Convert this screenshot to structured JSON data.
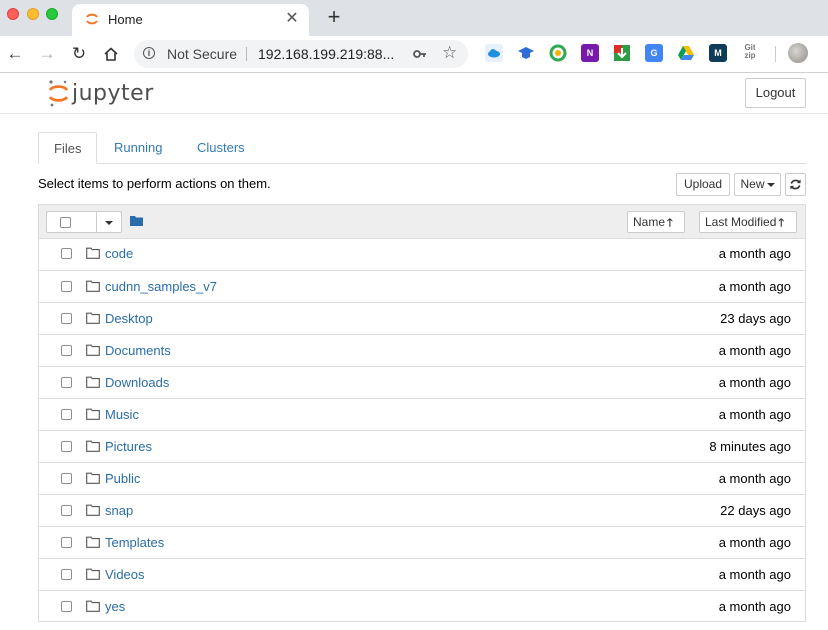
{
  "browser": {
    "tab_title": "Home",
    "new_tab": "+",
    "security_label": "Not Secure",
    "url": "192.168.199.219:88...",
    "extensions": [
      "onedrive-icon",
      "gradcap-icon",
      "chrome-circle-icon",
      "onenote-icon",
      "download-icon",
      "translate-icon",
      "drive-icon",
      "m-icon",
      "gitzip-icon"
    ]
  },
  "header": {
    "logo_text": "jupyter",
    "logout_label": "Logout"
  },
  "tabs": [
    {
      "label": "Files",
      "active": true
    },
    {
      "label": "Running",
      "active": false
    },
    {
      "label": "Clusters",
      "active": false
    }
  ],
  "toolbar": {
    "instructions": "Select items to perform actions on them.",
    "upload_label": "Upload",
    "new_label": "New"
  },
  "list_header": {
    "name_label": "Name",
    "modified_label": "Last Modified"
  },
  "files": [
    {
      "name": "code",
      "modified": "a month ago"
    },
    {
      "name": "cudnn_samples_v7",
      "modified": "a month ago"
    },
    {
      "name": "Desktop",
      "modified": "23 days ago"
    },
    {
      "name": "Documents",
      "modified": "a month ago"
    },
    {
      "name": "Downloads",
      "modified": "a month ago"
    },
    {
      "name": "Music",
      "modified": "a month ago"
    },
    {
      "name": "Pictures",
      "modified": "8 minutes ago"
    },
    {
      "name": "Public",
      "modified": "a month ago"
    },
    {
      "name": "snap",
      "modified": "22 days ago"
    },
    {
      "name": "Templates",
      "modified": "a month ago"
    },
    {
      "name": "Videos",
      "modified": "a month ago"
    },
    {
      "name": "yes",
      "modified": "a month ago"
    }
  ],
  "colors": {
    "link": "#296eaa",
    "jupyter_orange": "#f37726"
  }
}
